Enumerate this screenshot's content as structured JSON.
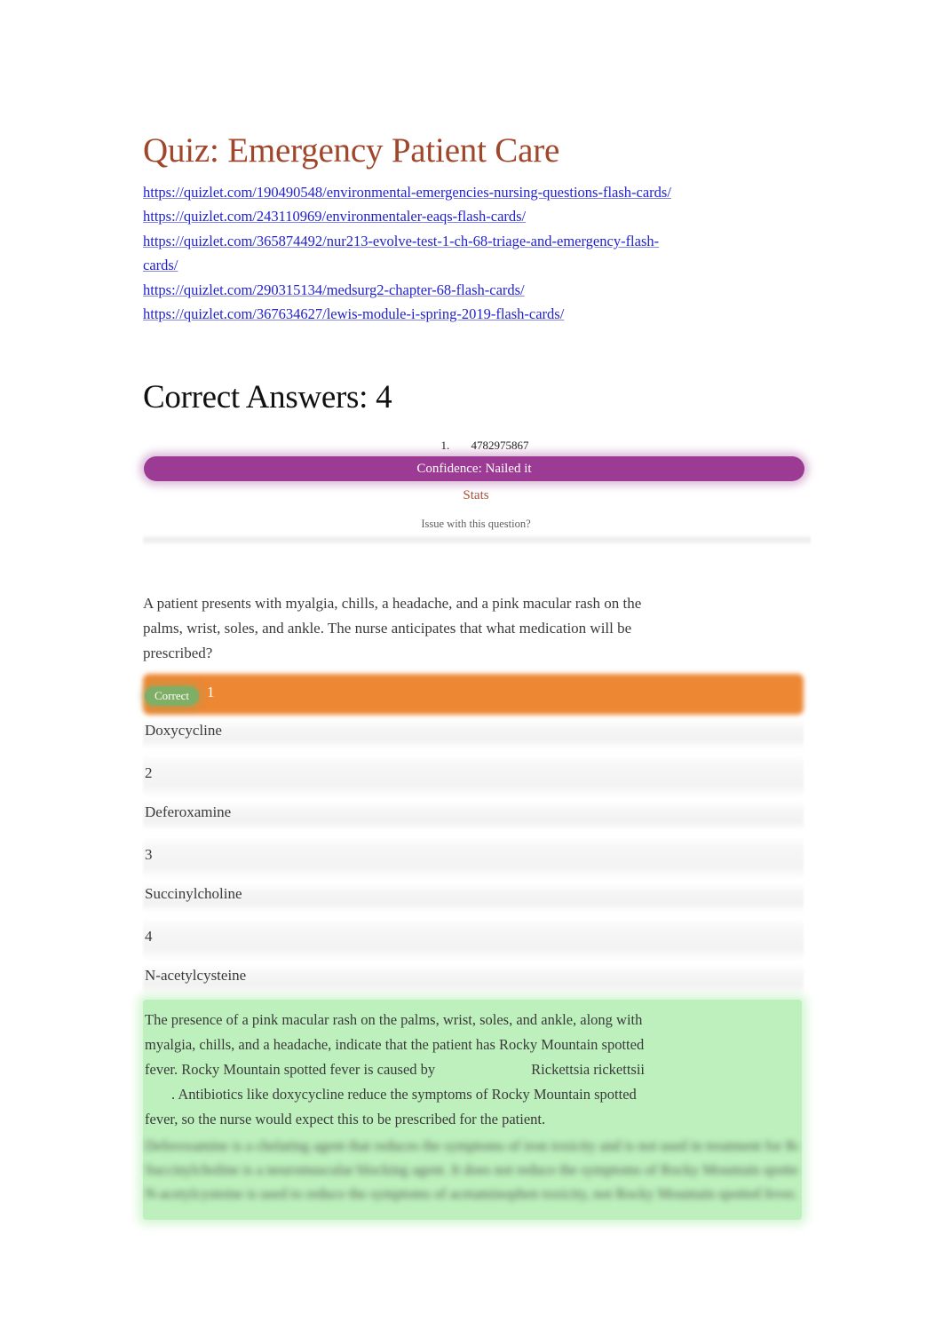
{
  "document": {
    "title": "Quiz: Emergency Patient Care",
    "title_color": "#a0462b"
  },
  "links": [
    {
      "text": "https://quizlet.com/190490548/environmental-emergencies-nursing-questions-flash-cards/"
    },
    {
      "text": "https://quizlet.com/243110969/environmentaler-eaqs-flash-cards/"
    },
    {
      "text": "https://quizlet.com/365874492/nur213-evolve-test-1-ch-68-triage-and-emergency-flash-cards/"
    },
    {
      "text": "https://quizlet.com/290315134/medsurg2-chapter-68-flash-cards/"
    },
    {
      "text": "https://quizlet.com/367634627/lewis-module-i-spring-2019-flash-cards/"
    }
  ],
  "results": {
    "heading": "Correct Answers: 4"
  },
  "question_header": {
    "item_number": "1.",
    "question_id": "4782975867",
    "confidence_label": "Confidence: Nailed it",
    "confidence_color": "#9c3b93",
    "stats_link": "Stats",
    "stats_color": "#a8503a",
    "issue_link": "Issue with this question?"
  },
  "question": {
    "text": "A patient presents with myalgia, chills, a headache, and a pink macular rash on the palms, wrist, soles, and ankle. The nurse anticipates that what medication will be prescribed?",
    "correct_badge": "Correct",
    "selected_index": "1",
    "selected_highlight_color": "#ed8733",
    "badge_color": "#7fae66"
  },
  "options": [
    {
      "index": "1",
      "label": "Doxycycline",
      "selected": true
    },
    {
      "index": "2",
      "label": "Deferoxamine",
      "selected": false
    },
    {
      "index": "3",
      "label": "Succinylcholine",
      "selected": false
    },
    {
      "index": "4",
      "label": "N-acetylcysteine",
      "selected": false
    }
  ],
  "rationale": {
    "background_color": "#bdf0bd",
    "part1": "The presence of a pink macular rash on the palms, wrist, soles, and ankle, along with myalgia, chills, and a headache, indicate that the patient has Rocky Mountain spotted fever. Rocky Mountain spotted fever is caused by",
    "organism": "Rickettsia rickettsii",
    "part2": ".",
    "part3": "Antibiotics like doxycycline reduce the symptoms of Rocky Mountain spotted fever, so the nurse would expect this to be prescribed for the patient.",
    "obscured_lines": [
      "Deferoxamine is a chelating agent that reduces the symptoms of iron toxicity and is not used in treatment for Rocky Mountain spotted fever.",
      "Succinylcholine is a neuromuscular blocking agent. It does not reduce the symptoms of Rocky Mountain spotted fever.",
      "N-acetylcysteine is used to reduce the symptoms of acetaminophen toxicity, not Rocky Mountain spotted fever."
    ]
  }
}
